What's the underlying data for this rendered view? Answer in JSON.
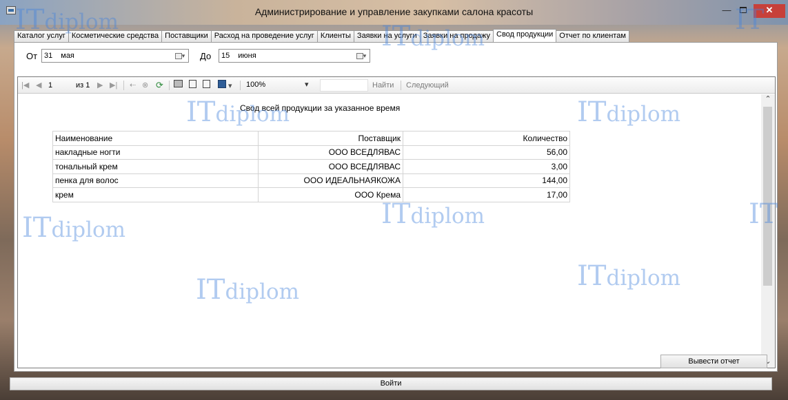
{
  "window": {
    "title": "Администрирование и управление закупками салона красоты",
    "close_glyph": "✕",
    "min_glyph": "—"
  },
  "tabs": [
    {
      "label": "Каталог услуг",
      "active": false
    },
    {
      "label": "Косметические средства",
      "active": false
    },
    {
      "label": "Поставщики",
      "active": false
    },
    {
      "label": "Расход на проведение услуг",
      "active": false
    },
    {
      "label": "Клиенты",
      "active": false
    },
    {
      "label": "Заявки на услуги",
      "active": false
    },
    {
      "label": "Заявки на продажу",
      "active": false
    },
    {
      "label": "Свод продукции",
      "active": true
    },
    {
      "label": "Отчет по клиентам",
      "active": false
    }
  ],
  "filters": {
    "from_label": "От",
    "from_day": "31",
    "from_month": "мая",
    "to_label": "До",
    "to_day": "15",
    "to_month": "июня"
  },
  "toolbar": {
    "page_current": "1",
    "page_of": "из 1",
    "zoom": "100%",
    "find_label": "Найти",
    "next_label": "Следующий"
  },
  "report": {
    "title": "Свод всей продукции за указанное время",
    "columns": [
      "Наименование",
      "Поставщик",
      "Количество"
    ],
    "rows": [
      [
        "накладные ногти",
        "ООО ВСЕДЛЯВАС",
        "56,00"
      ],
      [
        "тональный крем",
        "ООО ВСЕДЛЯВАС",
        "3,00"
      ],
      [
        "пенка для волос",
        "ООО ИДЕАЛЬНАЯКОЖА",
        "144,00"
      ],
      [
        "крем",
        "ООО Крема",
        "17,00"
      ]
    ]
  },
  "buttons": {
    "report": "Вывести отчет",
    "login": "Войти"
  },
  "watermark": {
    "it": "IT",
    "diplom": "diplom"
  },
  "colors": {
    "watermark": "#4682dc",
    "close_button": "#c7403a"
  }
}
